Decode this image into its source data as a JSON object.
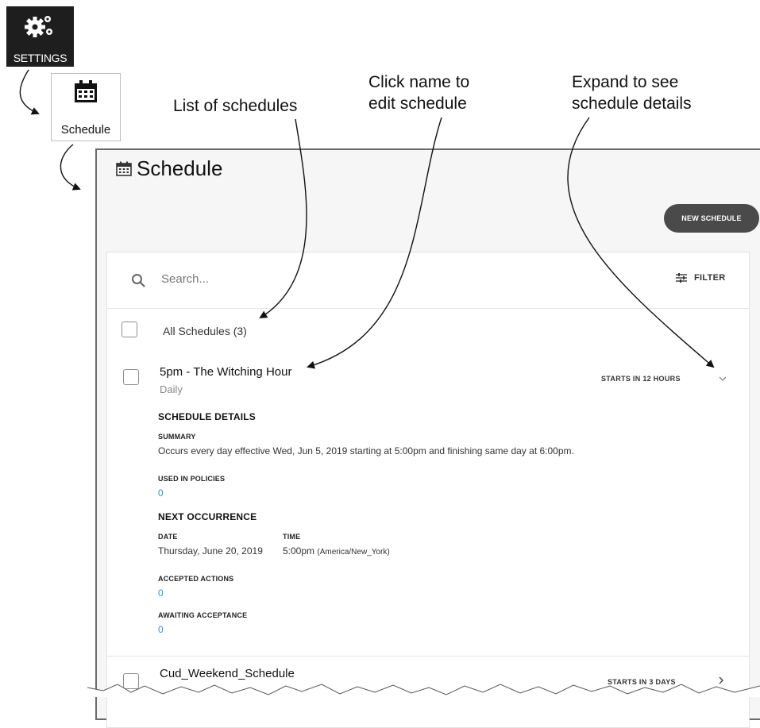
{
  "settings_tile": {
    "label": "SETTINGS",
    "icon": "gears-icon"
  },
  "schedule_tile": {
    "label": "Schedule",
    "icon": "calendar-icon"
  },
  "callouts": {
    "list": "List of schedules",
    "click_name": "Click name to\nedit schedule",
    "expand": "Expand to see\nschedule details"
  },
  "page": {
    "title": "Schedule",
    "new_button": "NEW SCHEDULE",
    "search_placeholder": "Search...",
    "filter_label": "FILTER",
    "all_schedules_label": "All Schedules (3)"
  },
  "schedules": [
    {
      "name": "5pm - The Witching Hour",
      "frequency": "Daily",
      "starts": "STARTS IN 12 HOURS",
      "expanded": true
    },
    {
      "name": "Cud_Weekend_Schedule",
      "frequency": "",
      "starts": "STARTS IN 3 DAYS",
      "expanded": false
    }
  ],
  "details": {
    "heading": "SCHEDULE DETAILS",
    "summary_label": "SUMMARY",
    "summary_text": "Occurs every day effective Wed, Jun 5, 2019 starting at 5:00pm and finishing same day at 6:00pm.",
    "used_label": "USED IN POLICIES",
    "used_value": "0",
    "next_heading": "NEXT OCCURRENCE",
    "date_label": "DATE",
    "time_label": "TIME",
    "date_value": "Thursday, June 20, 2019",
    "time_value": "5:00pm",
    "timezone": "(America/New_York)",
    "accepted_label": "ACCEPTED ACTIONS",
    "accepted_value": "0",
    "awaiting_label": "AWAITING ACCEPTANCE",
    "awaiting_value": "0"
  },
  "colors": {
    "link_blue": "#3a8fd8",
    "button_dark": "#4a4a4a",
    "tile_dark": "#1e1e1e"
  }
}
